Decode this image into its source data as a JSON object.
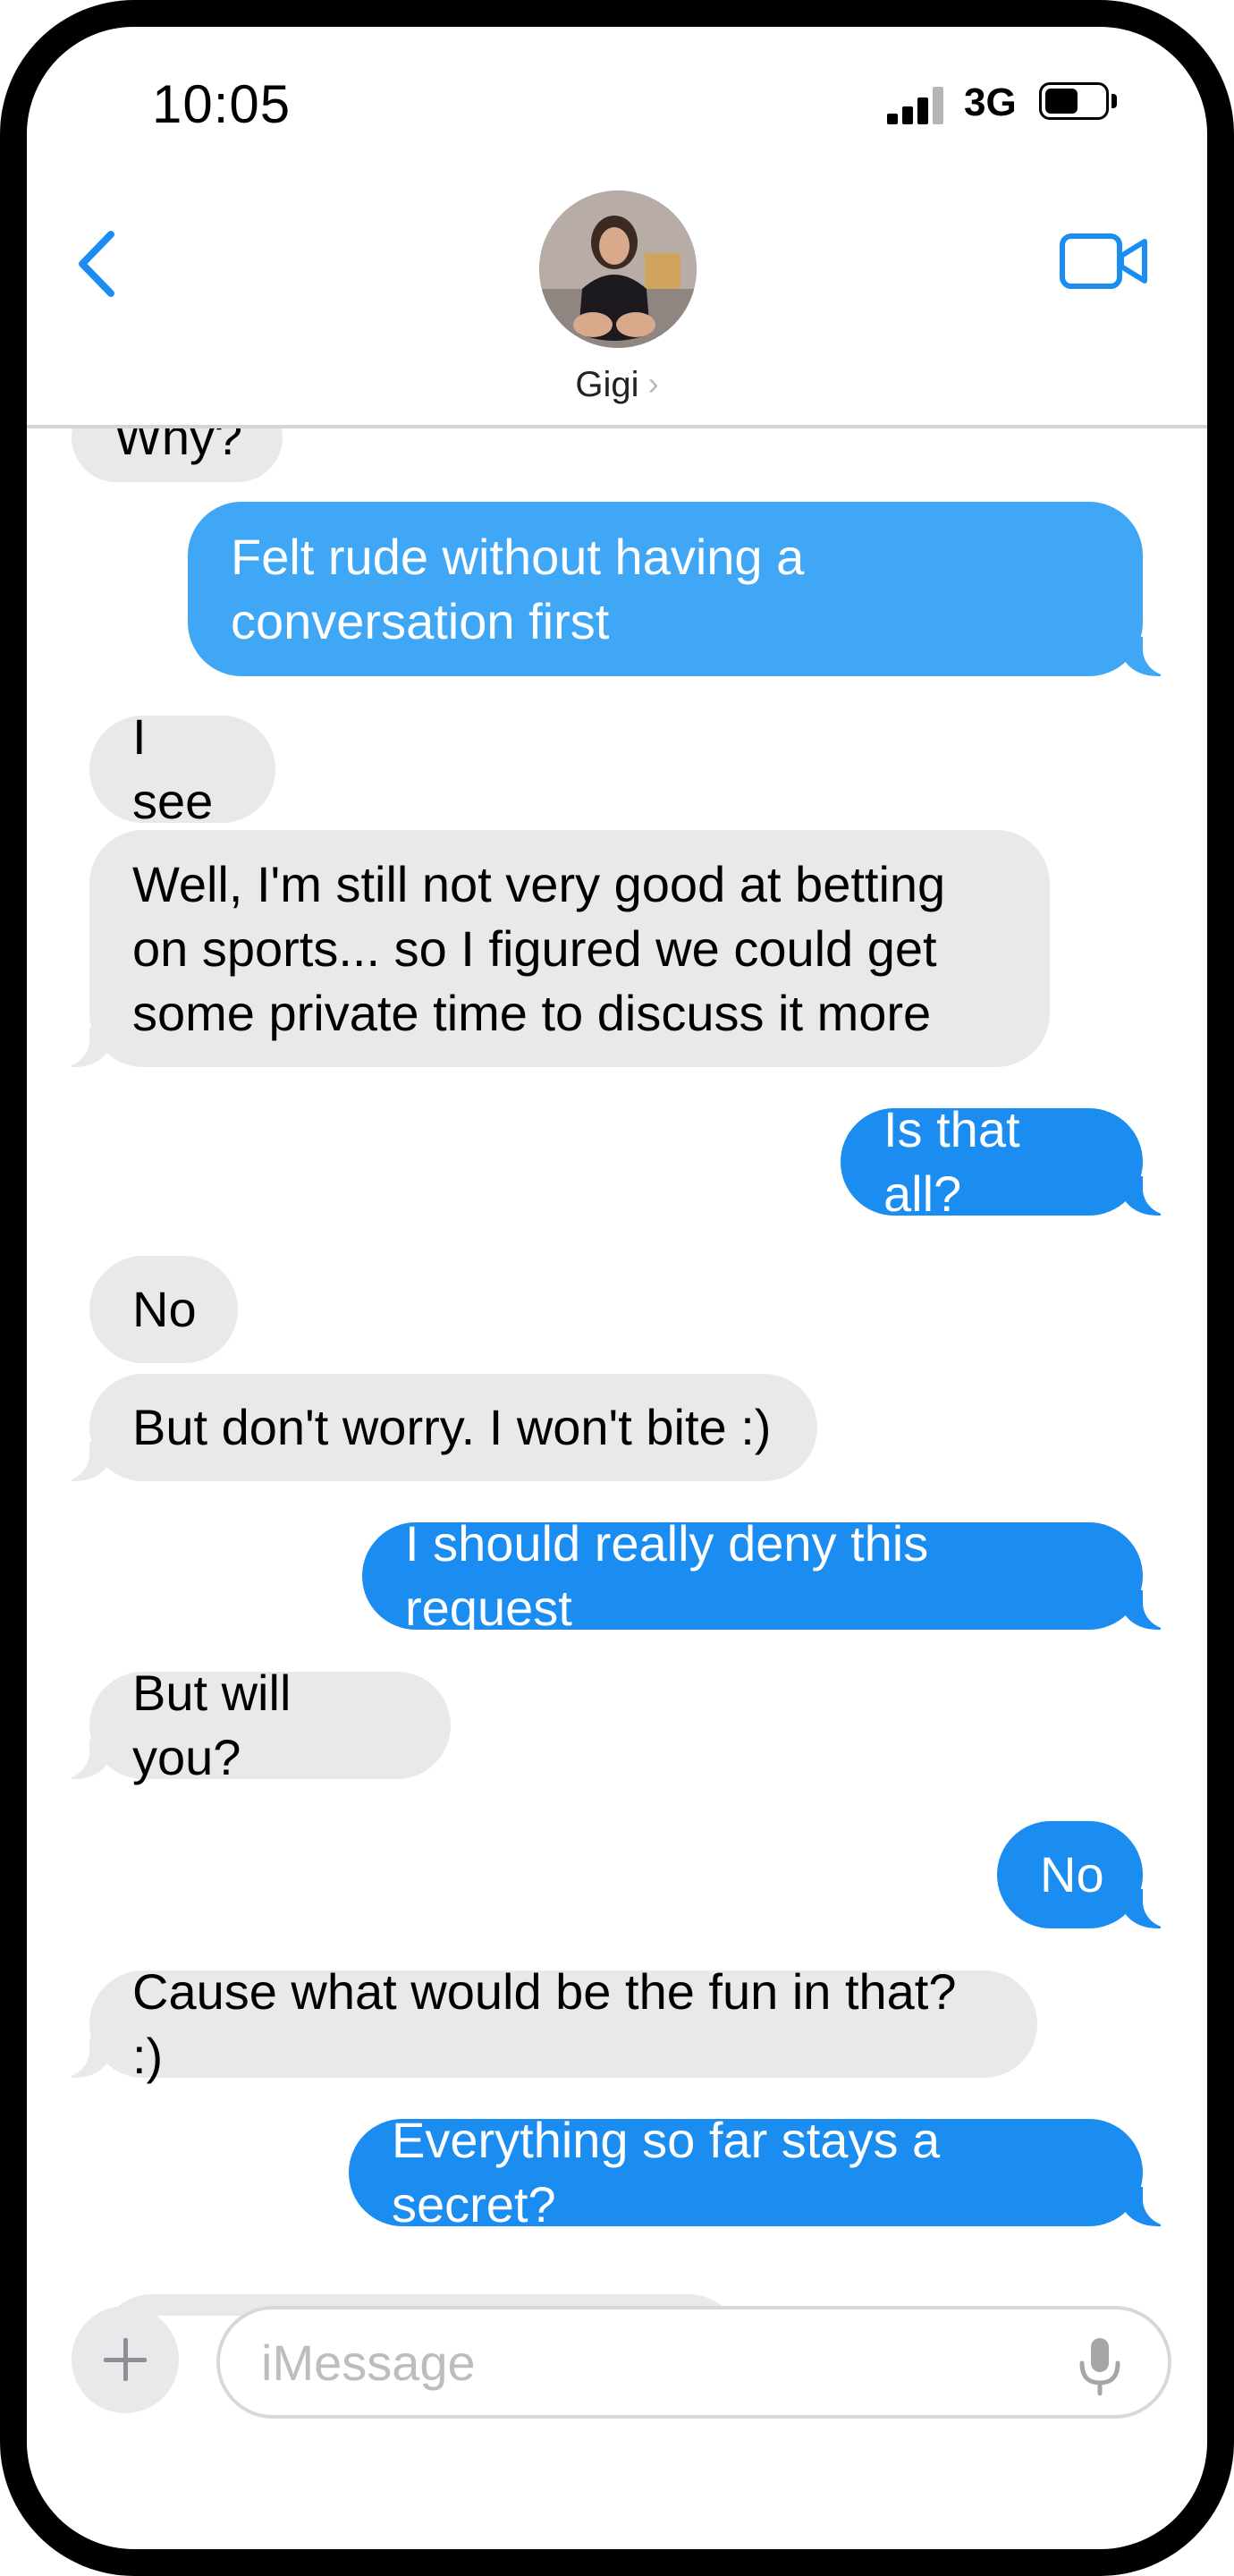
{
  "status_bar": {
    "time": "10:05",
    "network": "3G",
    "signal_bars": 3,
    "battery_level": 0.55
  },
  "header": {
    "contact_name": "Gigi",
    "back_icon": "chevron-left-icon",
    "video_icon": "video-camera-icon",
    "accent_color": "#1b8cf0"
  },
  "messages": [
    {
      "sender": "them",
      "text": "Why?"
    },
    {
      "sender": "me",
      "text": "Felt rude without having a conversation first"
    },
    {
      "sender": "them",
      "text": "I see"
    },
    {
      "sender": "them",
      "text": "Well, I'm still not very good at betting on sports... so I figured we could get some private time to discuss it more"
    },
    {
      "sender": "me",
      "text": "Is that all?"
    },
    {
      "sender": "them",
      "text": "No"
    },
    {
      "sender": "them",
      "text": "But don't worry.  I won't bite :)"
    },
    {
      "sender": "me",
      "text": "I should really deny this request"
    },
    {
      "sender": "them",
      "text": "But will you?"
    },
    {
      "sender": "me",
      "text": "No"
    },
    {
      "sender": "them",
      "text": "Cause what would be the fun in that? :)"
    },
    {
      "sender": "me",
      "text": "Everything so far stays a secret?"
    }
  ],
  "input": {
    "placeholder": "iMessage",
    "value": "",
    "plus_icon": "plus-icon",
    "mic_icon": "microphone-icon"
  },
  "colors": {
    "incoming_bubble": "#e9e9eb",
    "outgoing_bubble": "#1b8cf0"
  }
}
